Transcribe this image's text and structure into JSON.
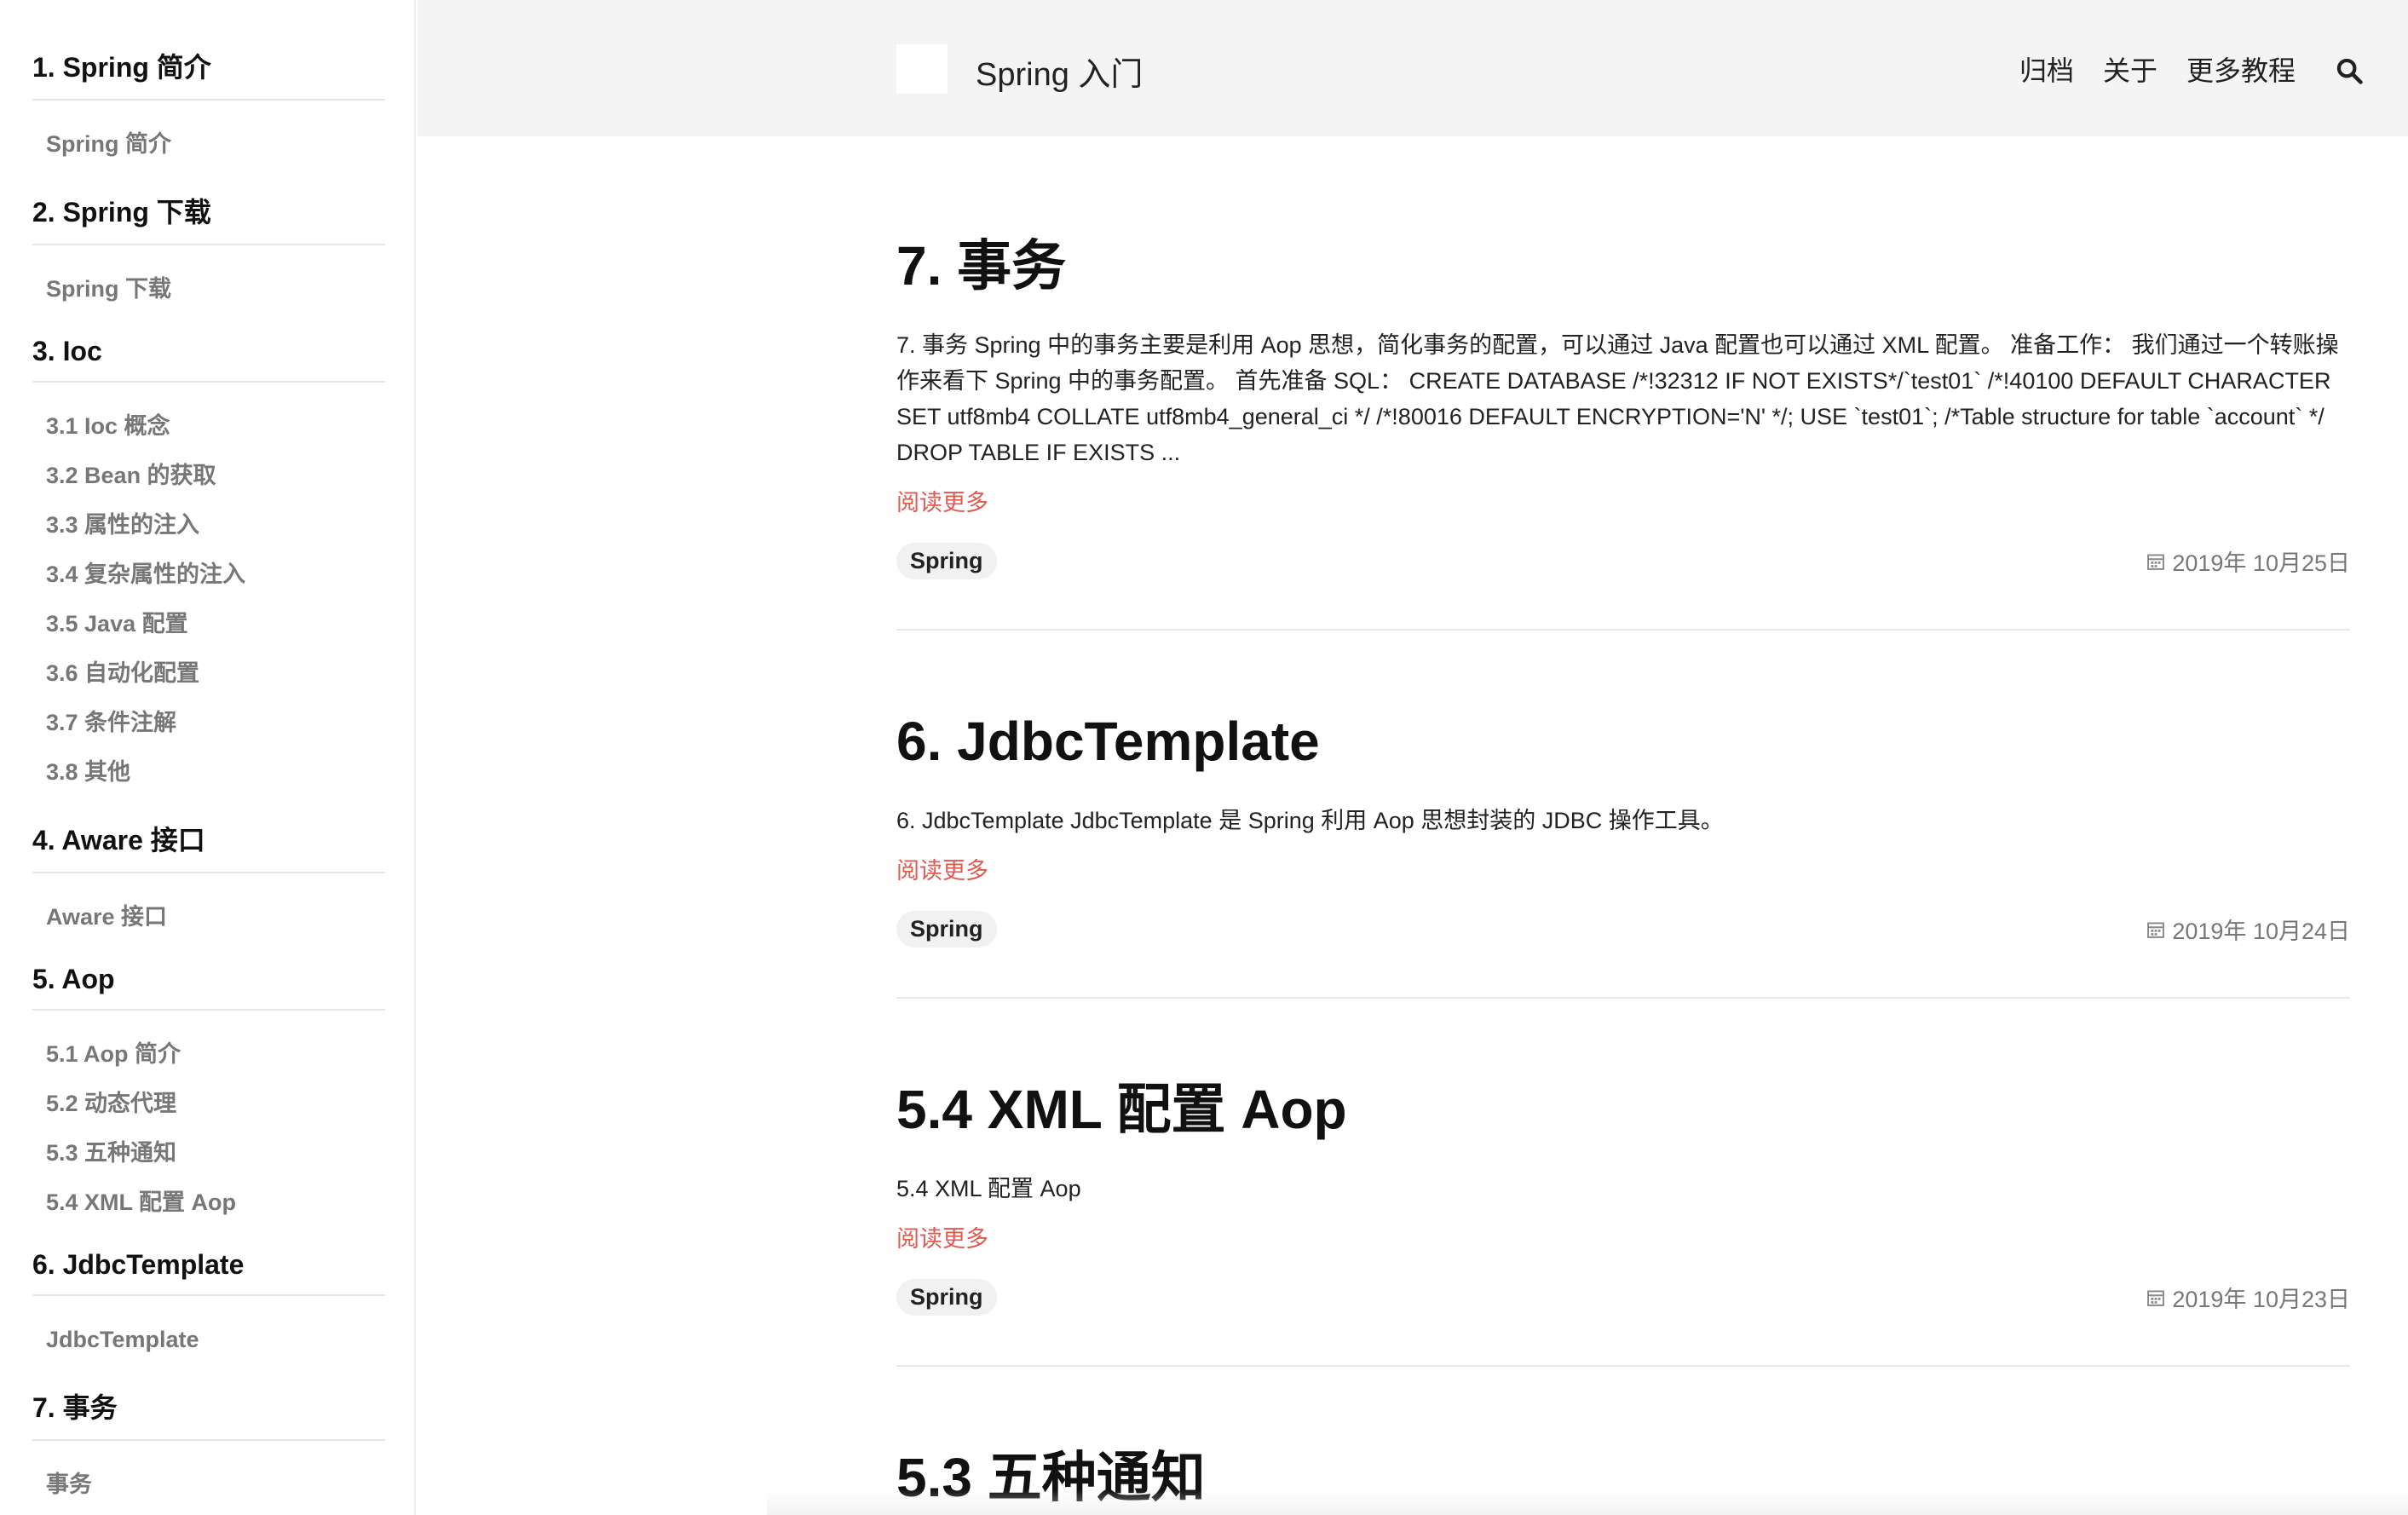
{
  "sidebar": {
    "sections": [
      {
        "title": "1. Spring 简介",
        "items": [
          "Spring 简介"
        ]
      },
      {
        "title": "2. Spring 下载",
        "items": [
          "Spring 下载"
        ]
      },
      {
        "title": "3. Ioc",
        "items": [
          "3.1 Ioc 概念",
          "3.2 Bean 的获取",
          "3.3 属性的注入",
          "3.4 复杂属性的注入",
          "3.5 Java 配置",
          "3.6 自动化配置",
          "3.7 条件注解",
          "3.8 其他"
        ]
      },
      {
        "title": "4. Aware 接口",
        "items": [
          "Aware 接口"
        ]
      },
      {
        "title": "5. Aop",
        "items": [
          "5.1 Aop 简介",
          "5.2 动态代理",
          "5.3 五种通知",
          "5.4 XML 配置 Aop"
        ]
      },
      {
        "title": "6. JdbcTemplate",
        "items": [
          "JdbcTemplate"
        ]
      },
      {
        "title": "7. 事务",
        "items": [
          "事务"
        ]
      }
    ]
  },
  "header": {
    "site_title": "Spring 入门",
    "nav": [
      "归档",
      "关于",
      "更多教程"
    ]
  },
  "posts": [
    {
      "title": "7. 事务",
      "excerpt": "7. 事务 Spring 中的事务主要是利用 Aop 思想，简化事务的配置，可以通过 Java 配置也可以通过 XML 配置。 准备工作： 我们通过一个转账操作来看下 Spring 中的事务配置。 首先准备 SQL： CREATE DATABASE /*!32312 IF NOT EXISTS*/`test01` /*!40100 DEFAULT CHARACTER SET utf8mb4 COLLATE utf8mb4_general_ci */ /*!80016 DEFAULT ENCRYPTION='N' */; USE `test01`; /*Table structure for table `account` */ DROP TABLE IF EXISTS ...",
      "read_more": "阅读更多",
      "tag": "Spring",
      "date": "2019年 10月25日"
    },
    {
      "title": "6. JdbcTemplate",
      "excerpt": "6. JdbcTemplate JdbcTemplate 是 Spring 利用 Aop 思想封装的 JDBC 操作工具。",
      "read_more": "阅读更多",
      "tag": "Spring",
      "date": "2019年 10月24日"
    },
    {
      "title": "5.4 XML 配置 Aop",
      "excerpt": "5.4 XML 配置 Aop",
      "read_more": "阅读更多",
      "tag": "Spring",
      "date": "2019年 10月23日"
    },
    {
      "title": "5.3 五种通知"
    }
  ],
  "colors": {
    "accent": "#e05a4f",
    "header_bg": "#f4f4f4",
    "muted": "#777777"
  },
  "icons": {
    "search": "search-icon",
    "calendar": "calendar-icon"
  }
}
